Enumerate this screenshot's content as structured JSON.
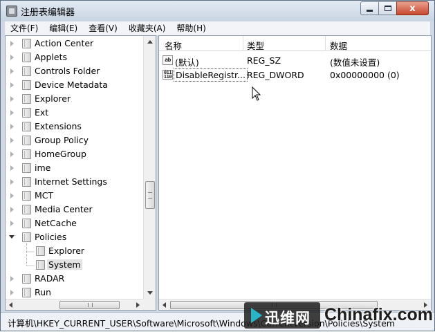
{
  "window": {
    "title": "注册表编辑器",
    "controls": {
      "close_glyph": "x"
    }
  },
  "menu": [
    "文件(F)",
    "编辑(E)",
    "查看(V)",
    "收藏夹(A)",
    "帮助(H)"
  ],
  "tree": {
    "items": [
      {
        "label": "Action Center",
        "expandable": true
      },
      {
        "label": "Applets",
        "expandable": true
      },
      {
        "label": "Controls Folder",
        "expandable": true
      },
      {
        "label": "Device Metadata",
        "expandable": true
      },
      {
        "label": "Explorer",
        "expandable": true
      },
      {
        "label": "Ext",
        "expandable": true
      },
      {
        "label": "Extensions",
        "expandable": true
      },
      {
        "label": "Group Policy",
        "expandable": true
      },
      {
        "label": "HomeGroup",
        "expandable": true
      },
      {
        "label": "ime",
        "expandable": true
      },
      {
        "label": "Internet Settings",
        "expandable": true
      },
      {
        "label": "MCT",
        "expandable": true
      },
      {
        "label": "Media Center",
        "expandable": true
      },
      {
        "label": "NetCache",
        "expandable": true
      },
      {
        "label": "Policies",
        "expandable": true,
        "expanded": true
      },
      {
        "label": "Explorer",
        "expandable": false,
        "child": true
      },
      {
        "label": "System",
        "expandable": false,
        "child": true,
        "selected": true
      },
      {
        "label": "RADAR",
        "expandable": true
      },
      {
        "label": "Run",
        "expandable": true
      }
    ],
    "scroll_icon": "scroll-grip-icon"
  },
  "list": {
    "columns": [
      "名称",
      "类型",
      "数据"
    ],
    "rows": [
      {
        "icon": "ab",
        "icon_name": "string-value-icon",
        "name": "(默认)",
        "type": "REG_SZ",
        "data": "(数值未设置)"
      },
      {
        "icon": "011\n110",
        "icon_name": "binary-value-icon",
        "name": "DisableRegistr...",
        "type": "REG_DWORD",
        "data": "0x00000000 (0)"
      }
    ]
  },
  "status": {
    "path": "计算机\\HKEY_CURRENT_USER\\Software\\Microsoft\\Windows\\CurrentVersion\\Policies\\System"
  },
  "watermark": {
    "zh": "迅维网",
    "en": "Chinafix.com"
  },
  "colors": {
    "accent_close": "#c9472d",
    "frame": "#cfd8e3",
    "watermark_arrow": "#27b6c8"
  }
}
